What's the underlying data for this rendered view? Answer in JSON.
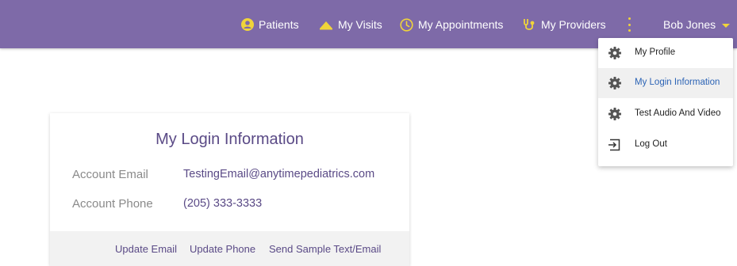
{
  "navbar": {
    "items": [
      {
        "label": "Patients",
        "icon": "user-circle-icon"
      },
      {
        "label": "My Visits",
        "icon": "mountain-icon"
      },
      {
        "label": "My Appointments",
        "icon": "clock-icon"
      },
      {
        "label": "My Providers",
        "icon": "stethoscope-icon"
      }
    ],
    "more_icon": "kebab-icon",
    "user_name": "Bob Jones"
  },
  "dropdown": {
    "items": [
      {
        "label": "My Profile",
        "icon": "gear-icon"
      },
      {
        "label": "My Login Information",
        "icon": "gear-icon",
        "active": true
      },
      {
        "label": "Test Audio And Video",
        "icon": "gear-icon"
      },
      {
        "label": "Log Out",
        "icon": "logout-icon"
      }
    ]
  },
  "card": {
    "title": "My Login Information",
    "email_label": "Account Email",
    "email_value": "TestingEmail@anytimepediatrics.com",
    "phone_label": "Account Phone",
    "phone_value": "(205) 333-3333",
    "links": [
      "Update Email",
      "Update Phone",
      "Send Sample Text/Email"
    ]
  },
  "colors": {
    "navbar_bg": "#7e6aa8",
    "icon_accent": "#f0d43a",
    "active_link": "#2b63b5",
    "card_text": "#5a4a86"
  }
}
